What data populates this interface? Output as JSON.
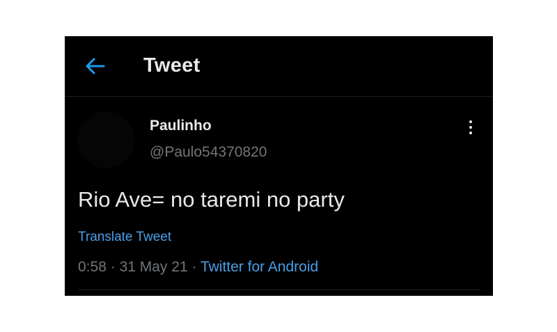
{
  "header": {
    "title": "Tweet",
    "back_icon": "arrow-left-icon",
    "accent_color": "#1d9bf0"
  },
  "author": {
    "display_name": "Paulinho",
    "handle": "@Paulo54370820"
  },
  "tweet": {
    "text": "Rio Ave= no taremi no party",
    "translate_label": "Translate Tweet",
    "time": "0:58",
    "date": "31 May 21",
    "separator": "·",
    "source": "Twitter for Android"
  },
  "menu": {
    "more_icon": "vertical-ellipsis-icon"
  },
  "colors": {
    "background": "#000000",
    "primary_text": "#e7e9ea",
    "secondary_text": "#71767b",
    "link": "#4a9fe8"
  }
}
